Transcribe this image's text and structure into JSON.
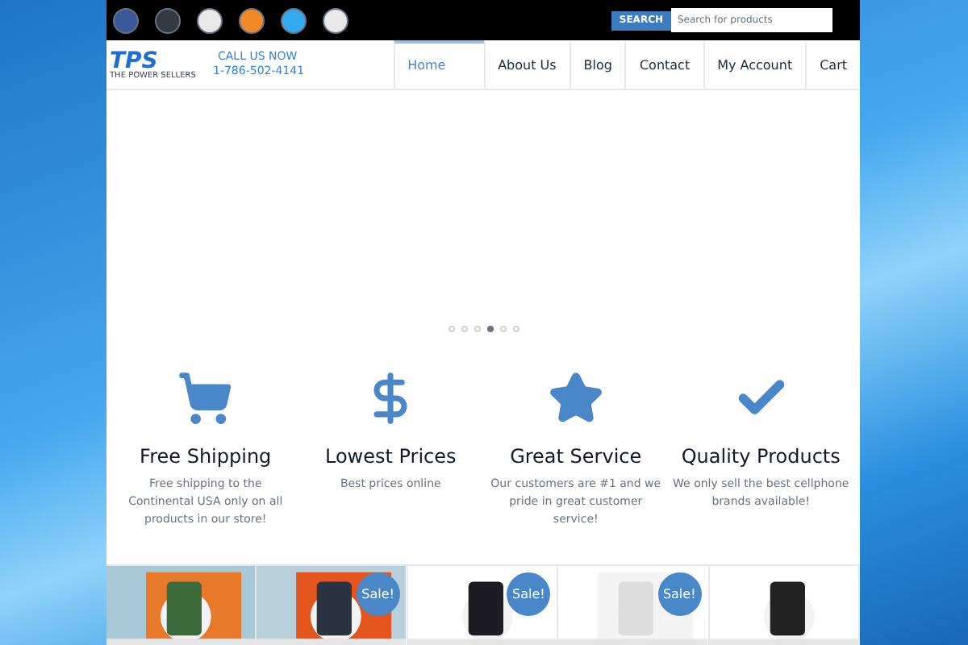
{
  "social_links": [
    {
      "color": "#3b5998"
    },
    {
      "color": "#333a44"
    },
    {
      "color": "#e8e8e8"
    },
    {
      "color": "#f08a24"
    },
    {
      "color": "#33aaee"
    },
    {
      "color": "#e8e8e8"
    }
  ],
  "search": {
    "button": "SEARCH",
    "placeholder": "Search for products"
  },
  "header": {
    "logo": "TPS",
    "logo_tagline": "THE POWER SELLERS",
    "call_label": "CALL US NOW",
    "phone": "1-786-502-4141"
  },
  "nav": [
    {
      "label": "Home",
      "selected": true
    },
    {
      "label": "About Us",
      "selected": false
    },
    {
      "label": "Blog",
      "selected": false
    },
    {
      "label": "Contact",
      "selected": false
    },
    {
      "label": "My Account",
      "selected": false
    },
    {
      "label": "Cart",
      "selected": false
    }
  ],
  "slider_dots": [
    {
      "selected": false
    },
    {
      "selected": false
    },
    {
      "selected": false
    },
    {
      "selected": true
    },
    {
      "selected": false
    },
    {
      "selected": false
    }
  ],
  "features": [
    {
      "kind": "cart",
      "title": "Free Shipping",
      "text": "Free shipping to the Continental USA only on all products in our store!"
    },
    {
      "kind": "dollar",
      "title": "Lowest Prices",
      "text": "Best prices online"
    },
    {
      "kind": "star",
      "title": "Great Service",
      "text": "Our customers are #1 and we pride in great customer service!"
    },
    {
      "kind": "check",
      "title": "Quality Products",
      "text": "We only sell the best cellphone brands available!"
    }
  ],
  "products": [
    {
      "kind": "picture"
    },
    {
      "kind": "picture",
      "badge": "Sale!"
    },
    {
      "kind": "picture",
      "badge": "Sale!"
    },
    {
      "kind": "picture",
      "badge": "Sale!"
    },
    {
      "kind": "picture"
    }
  ]
}
